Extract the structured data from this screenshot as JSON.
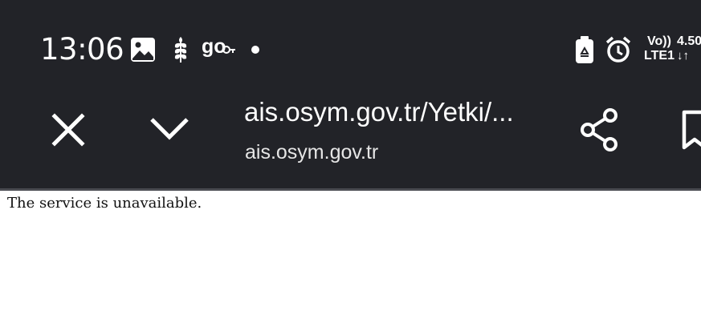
{
  "status_bar": {
    "time": "13:06",
    "app_icons": [
      "image-icon",
      "wheat-icon",
      "go-icon",
      "notification-dot-icon"
    ],
    "go_label": "go",
    "system_icons": [
      "battery-saver-icon",
      "alarm-icon"
    ],
    "volte_label": "Vo))",
    "lte_label": "LTE1",
    "network_speed": "4.50",
    "network_arrows": "↓↑"
  },
  "toolbar": {
    "close_icon": "close-icon",
    "collapse_icon": "chevron-down-icon",
    "url_title": "ais.osym.gov.tr/Yetki/...",
    "url_domain": "ais.osym.gov.tr",
    "share_icon": "share-icon",
    "bookmark_icon": "bookmark-icon"
  },
  "page": {
    "message": "The service is unavailable."
  },
  "colors": {
    "chrome_background": "#222328",
    "chrome_divider": "#4a4b51",
    "page_background": "#ffffff",
    "text_dark": "#111111"
  }
}
